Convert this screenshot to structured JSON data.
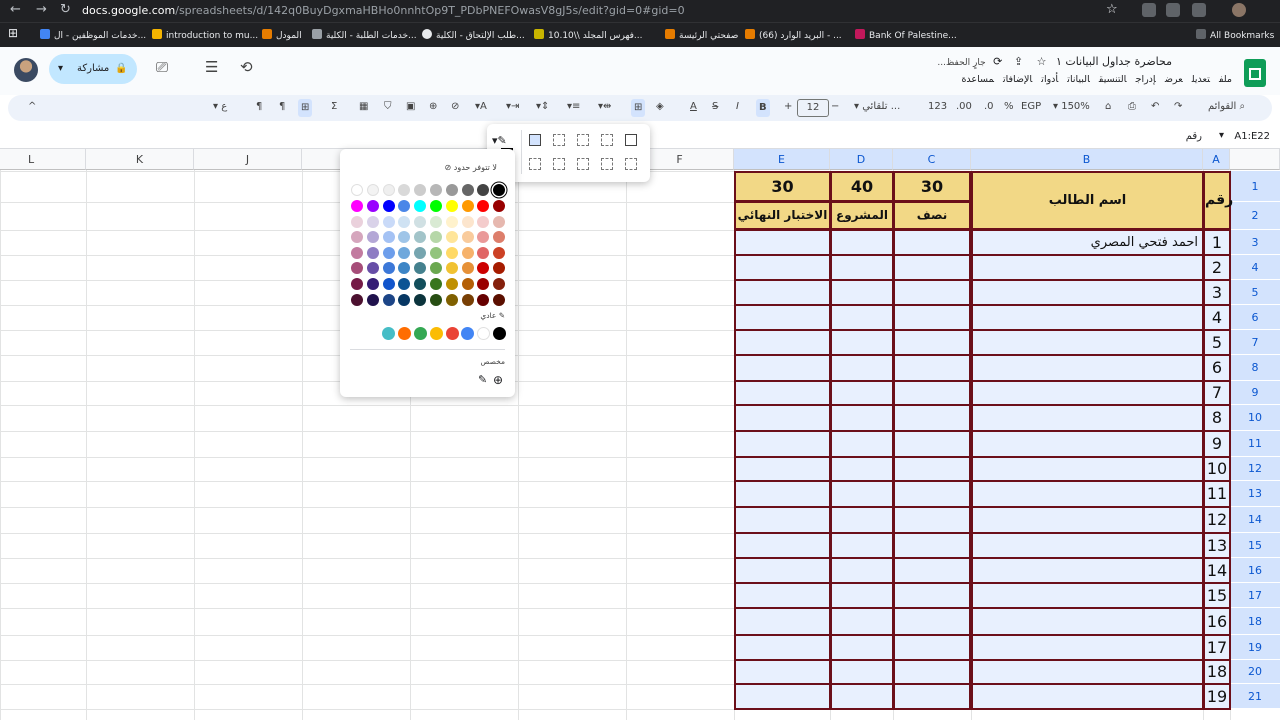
{
  "browser": {
    "url_domain": "docs.google.com",
    "url_rest": "/spreadsheets/d/142q0BuyDgxmaHBHo0nnhtOp9T_PDbPNEFOwasV8gJ5s/edit?gid=0#gid=0",
    "bookmarks": [
      "خدمات الموظفين - ال...",
      "introduction to mu...",
      "المودل",
      "خدمات الطلبة - الكلية...",
      "طلب الإلتحاق - الكلية...",
      "فهرس المجلد \\\\10.10...",
      "صفحتي الرئيسة",
      "(66) البريد الوارد - ...",
      "Bank Of Palestine..."
    ],
    "all_bookmarks": "All Bookmarks"
  },
  "app": {
    "title": "محاضرة جداول البيانات ١",
    "saving": "جارٍ الحفظ...",
    "menus": [
      "ملف",
      "تعديل",
      "عرض",
      "إدراج",
      "التنسيق",
      "البيانات",
      "أدوات",
      "الإضافات",
      "مساعدة"
    ],
    "share_label": "مشاركة"
  },
  "toolbar": {
    "search": "القوائم",
    "zoom": "150%",
    "currency": "EGP",
    "percent": "%",
    "dec_dec": ".0",
    "dec_inc": ".00",
    "format123": "123",
    "font": "تلقائي ...",
    "font_size": "12"
  },
  "formula": {
    "name_box": "A1:E22",
    "content": "رقم"
  },
  "columns": [
    "L",
    "K",
    "J",
    "I",
    "H",
    "G",
    "F",
    "E",
    "D",
    "C",
    "B",
    "A"
  ],
  "rows": [
    "1",
    "2",
    "3",
    "4",
    "5",
    "6",
    "7",
    "8",
    "9",
    "10",
    "11",
    "12",
    "13",
    "14",
    "15",
    "16",
    "17",
    "18",
    "19",
    "20",
    "21"
  ],
  "table": {
    "header_number": "رقم",
    "header_name": "اسم الطالب",
    "max_midterm": "30",
    "max_project": "40",
    "max_final": "30",
    "label_midterm": "نصف الفصل",
    "label_project": "المشروع",
    "label_final": "الاختبار النهائي",
    "numbers": [
      "1",
      "2",
      "3",
      "4",
      "5",
      "6",
      "7",
      "8",
      "9",
      "10",
      "11",
      "12",
      "13",
      "14",
      "15",
      "16",
      "17",
      "18",
      "19"
    ],
    "student_1": "احمد فتحي المصري"
  },
  "color_popup": {
    "no_borders": "لا تتوفر حدود",
    "standard_label": "عادي",
    "custom_label": "مخصص",
    "selected_color": "#000000"
  }
}
